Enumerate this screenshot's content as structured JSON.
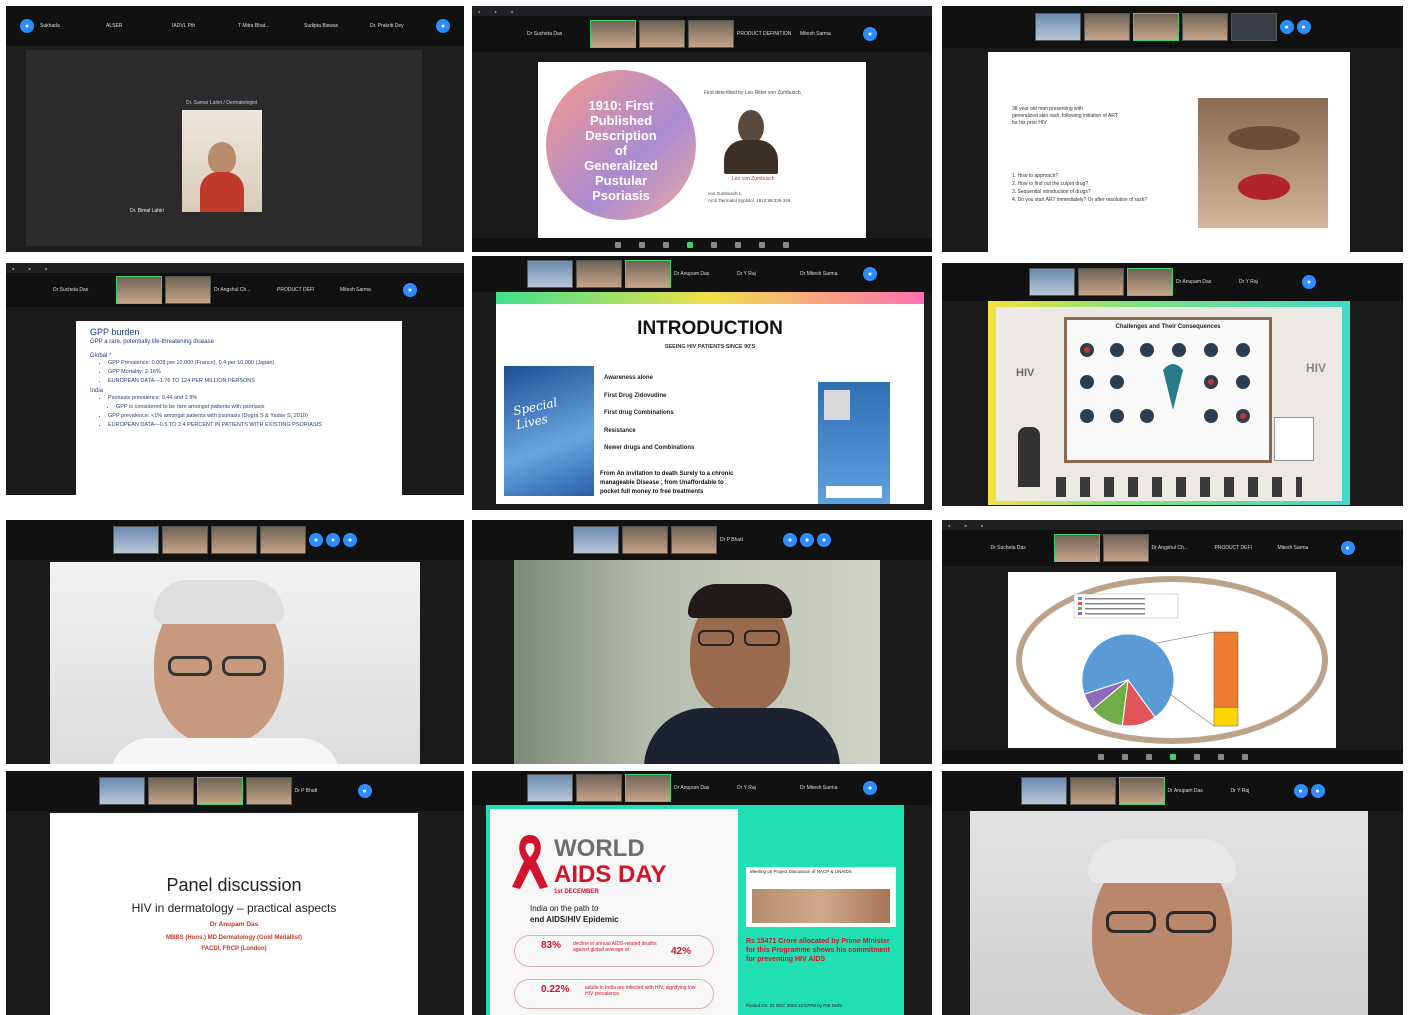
{
  "tiles": {
    "t1": {
      "names": [
        "Sukhada",
        "ALSER",
        "IADVL Pth",
        "T Mitra Bhat...",
        "Sudipta Biswas",
        "Dr. Prakriti Dey"
      ],
      "speaker_label": "Dr. Samar Lahiri / Dermatologist",
      "cam_label": "Dr. Bimal Lahiri"
    },
    "t2": {
      "names": [
        "Dr Sucheta Das",
        "PRODUCT DEFINITION",
        "Mitesh Sarma"
      ],
      "circle_title": [
        "1910: First",
        "Published",
        "Description",
        "of",
        "Generalized",
        "Pustular",
        "Psoriasis"
      ],
      "caption": "First described by Leo Ritter von Zumbusch",
      "bust_label": "Leo von Zumbusch",
      "ref_lines": [
        "von Zumbusch L.",
        "Arch Dermatol Syphilol. 1910;99:335-346"
      ]
    },
    "t3": {
      "text_lines": [
        "38 year old man presenting with",
        "generalized skin rash, following initiation of ART",
        "for his prior HIV"
      ],
      "questions": [
        "1.  How to approach?",
        "2.  How to find out the culprit drug?",
        "3.  Sequential introduction of drugs?",
        "4.  Do you start ART immediately? Or after resolution of rash?"
      ]
    },
    "t4": {
      "names": [
        "Dr Sucheta Das",
        "Dr Angshul Ch...",
        "PRODUCT DEFI",
        "Mitesh Sarma"
      ],
      "title": "GPP burden",
      "subtitle": "GPP a rare, potentially life-threatening disease",
      "global": "Global *",
      "bullets": [
        "GPP Prevalence: 0.008 per 10,000 (France), 0.4 per 10,000 (Japan)",
        "GPP Mortality: 2-16%",
        "EUROPEAN DATA—1.76 TO 124 PER MILLION PERSONS"
      ],
      "india": "India",
      "india_bullets": [
        "Psoriasis prevalence: 0.44 and 2.8%",
        "GPP is considered to be rare amongst patients with psoriasis",
        "GPP prevalence: <1% amongst patients with psoriasis (Dogra S & Yadav S, 2010)",
        "EUROPEAN DATA—0.5 TO 2.4 PERCENT IN PATIENTS WITH EXISTING PSORIASIS"
      ]
    },
    "t5": {
      "names": [
        "Dr Anupam Das",
        "Dr Y Raj",
        "Dr Mitesh Sarma"
      ],
      "title": "INTRODUCTION",
      "subtitle": "SEEING HIV PATIENTS SINCE 90'S",
      "book_title": "Special Lives",
      "points": [
        "Awareness alone",
        "First Drug Zidovudine",
        "First drug Combinations",
        "Resistance",
        "Newer drugs and Combinations"
      ],
      "closing": [
        "From An invitation to death Surely to a chronic",
        "manageable Disease ; from Unaffordable to",
        "pocket full money to free treatments"
      ]
    },
    "t6": {
      "names": [
        "Dr Anupam Das",
        "Dr Y Raj"
      ],
      "board_title": "Challenges and Their Consequences",
      "left_text": "HIV",
      "right_text": "HIV"
    },
    "t8": {
      "names": [
        "Dr P Bhatt"
      ]
    },
    "t9": {
      "names": [
        "Dr Sucheta Das",
        "Dr Angshul Ch...",
        "PRODUCT DEFI",
        "Mitesh Sarma"
      ],
      "pie": [
        {
          "label": "Blue",
          "value": 70,
          "color": "#5b9bd5"
        },
        {
          "label": "Red",
          "value": 12,
          "color": "#e15759"
        },
        {
          "label": "Green",
          "value": 12,
          "color": "#70ad47"
        },
        {
          "label": "Purple",
          "value": 6,
          "color": "#8e6bb8"
        }
      ],
      "bar": [
        {
          "value": 80,
          "color": "#ed7d31"
        },
        {
          "value": 20,
          "color": "#ffd700"
        }
      ]
    },
    "t10": {
      "names": [
        "Dr P Bhatt"
      ],
      "title": "Panel discussion",
      "subtitle": "HIV in dermatology – practical aspects",
      "presenter": "Dr Anupam Das",
      "credentials": [
        "MBBS (Hons.) MD Dermatology (Gold Medallist)",
        "FACDI, FRCP (London)"
      ]
    },
    "t11": {
      "names": [
        "Dr Anupam Das",
        "Dr Y Raj",
        "Dr Mitesh Sarma"
      ],
      "title_1": "WORLD",
      "title_2": "AIDS DAY",
      "date": "1st DECEMBER",
      "tagline": [
        "India on the path to",
        "end AIDS/HIV Epidemic"
      ],
      "stat1_value": "83%",
      "stat1_text": "decline in annual AIDS-related deaths against global average of",
      "stat1_avg": "42%",
      "stat2_value": "0.22%",
      "stat2_text": "adults in India are infected with HIV, signifying low HIV prevalence",
      "box1": "Meeting on Project Discussion of NACP & UNAIDS",
      "box2": "Rs 15471 Crore allocated by Prime Minister for this Programme shows his commitment for preventing HIV AIDS",
      "footer": "Posted On: 01 DEC 2023 12:57PM by PIB Delhi"
    },
    "t12": {
      "names": [
        "Dr Anupam Das",
        "Dr Y Raj"
      ]
    }
  }
}
